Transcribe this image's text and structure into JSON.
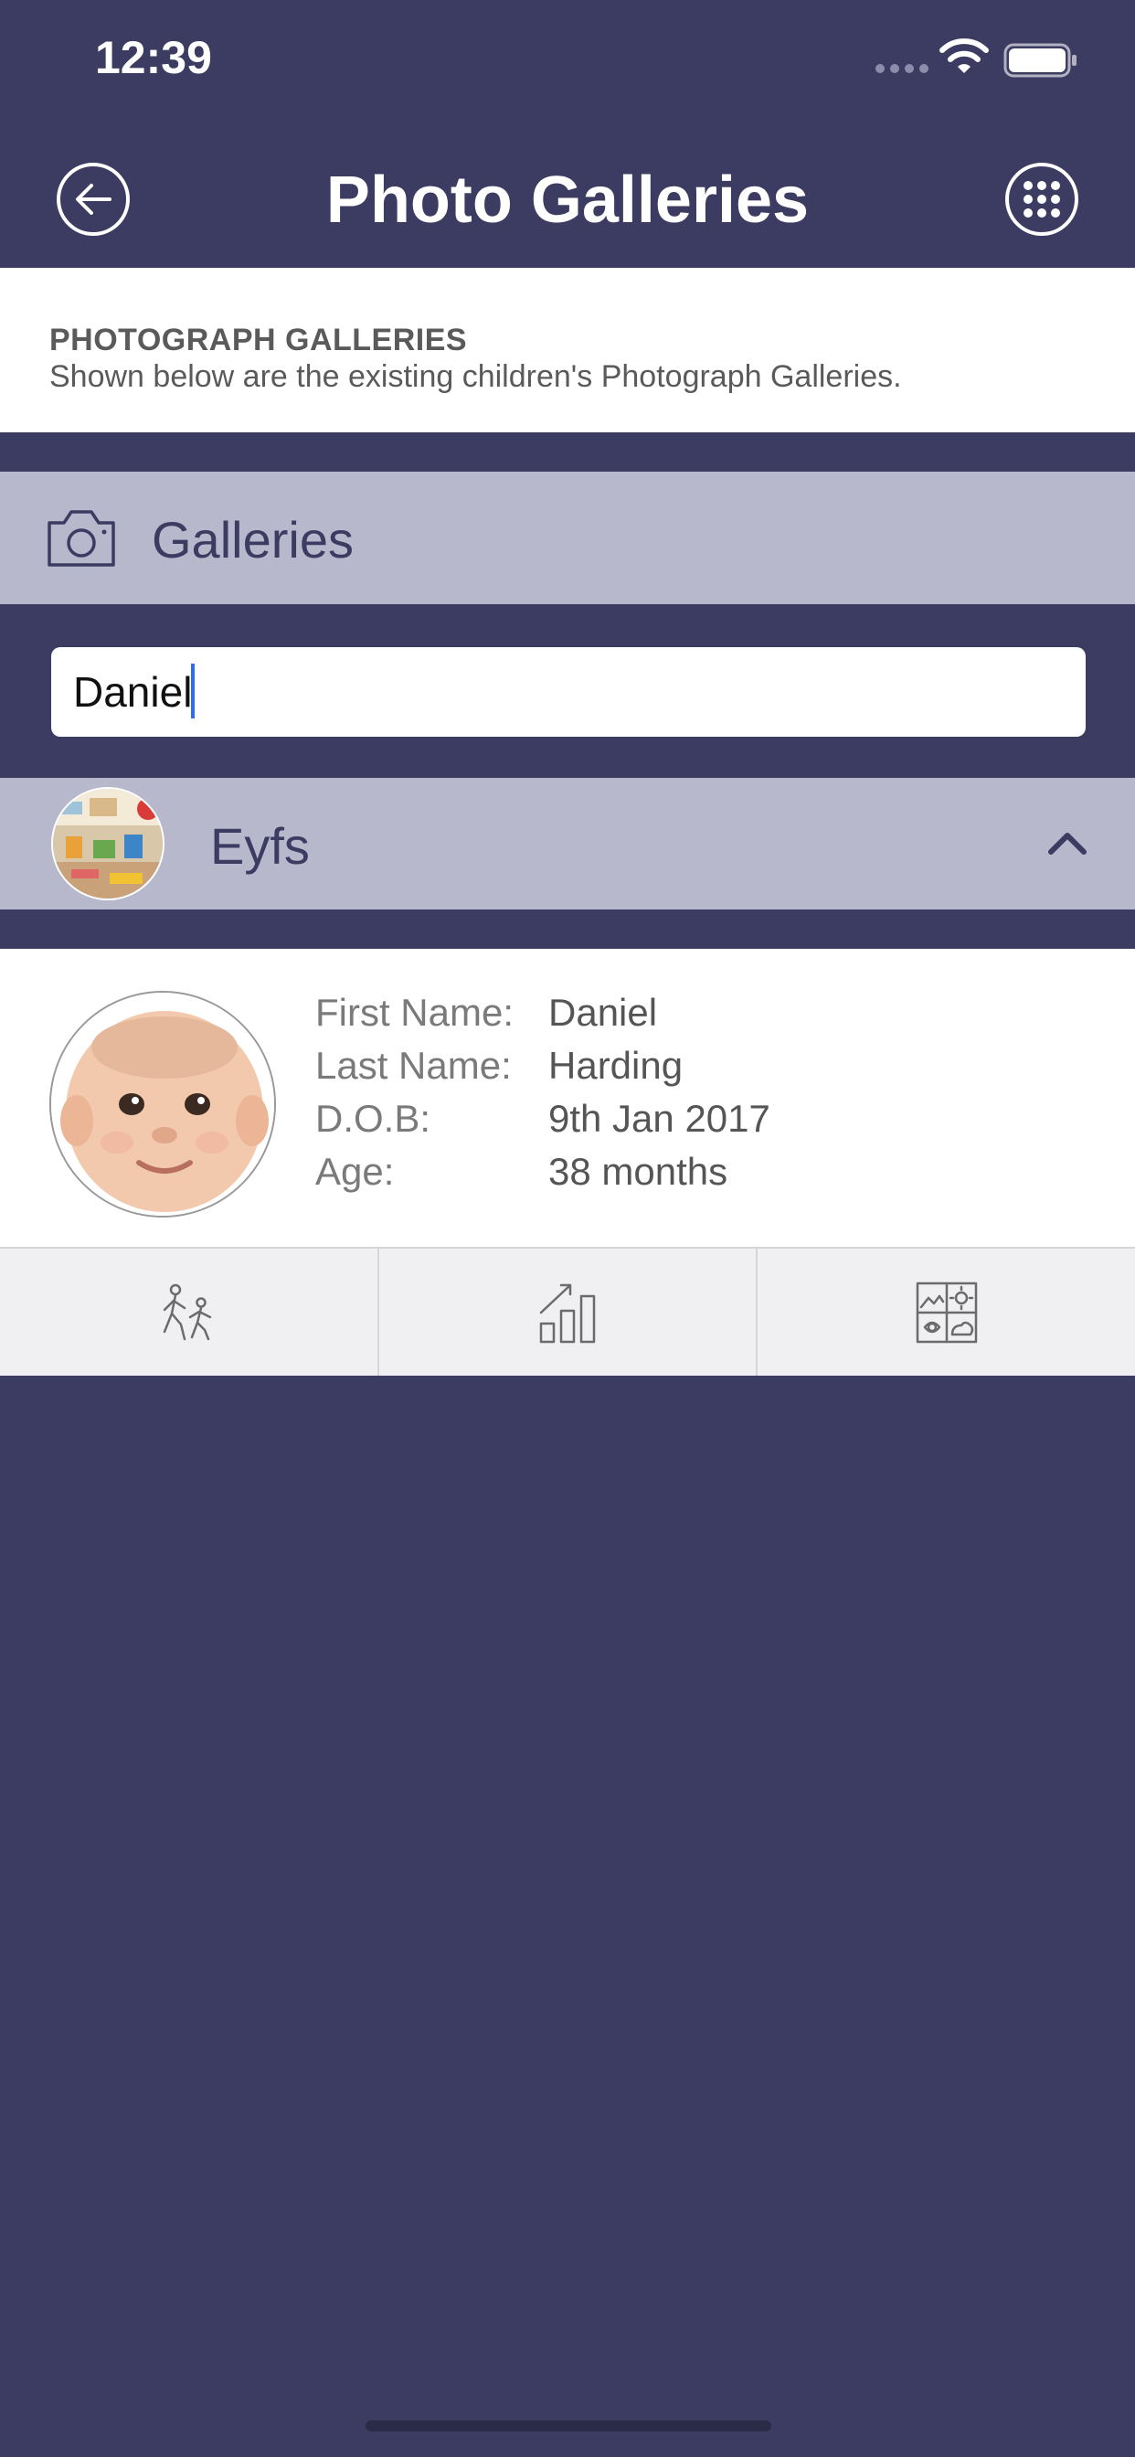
{
  "status_bar": {
    "time": "12:39"
  },
  "nav": {
    "title": "Photo Galleries",
    "back_icon": "arrow-left-icon",
    "menu_icon": "grid-menu-icon"
  },
  "info": {
    "heading": "PHOTOGRAPH GALLERIES",
    "description": "Shown below are the existing children's Photograph Galleries."
  },
  "galleries": {
    "label": "Galleries",
    "icon": "camera-icon"
  },
  "search": {
    "value": "Daniel"
  },
  "group": {
    "label": "Eyfs",
    "expanded": true
  },
  "child": {
    "fields": [
      {
        "label": "First Name:",
        "value": "Daniel"
      },
      {
        "label": "Last Name:",
        "value": "Harding"
      },
      {
        "label": "D.O.B:",
        "value": "9th Jan 2017"
      },
      {
        "label": "Age:",
        "value": "38 months"
      }
    ]
  },
  "actions": [
    {
      "icon": "walking-people-icon"
    },
    {
      "icon": "bar-chart-icon"
    },
    {
      "icon": "photo-gallery-icon"
    }
  ],
  "colors": {
    "nav_background": "#3c3c62",
    "section_header": "#b8b8cc",
    "panel": "#ffffff",
    "caret": "#2f6cf3"
  }
}
